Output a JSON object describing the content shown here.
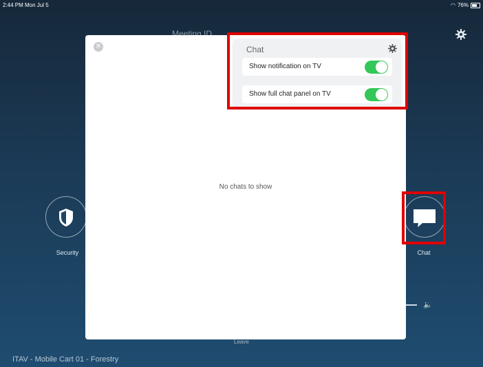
{
  "status": {
    "time": "2:44 PM  Mon Jul 5",
    "battery": "76%"
  },
  "background": {
    "meeting_title": "Meeting ID"
  },
  "side": {
    "security_label": "Security",
    "chat_label": "Chat",
    "leave_label": "Leave"
  },
  "footer": {
    "room_name": "ITAV - Mobile Cart 01 - Forestry"
  },
  "modal": {
    "empty_text": "No chats to show"
  },
  "popover": {
    "title": "Chat",
    "options": [
      {
        "label": "Show notification on TV",
        "enabled": true
      },
      {
        "label": "Show full chat panel on TV",
        "enabled": true
      }
    ]
  },
  "colors": {
    "toggle_on": "#34c759",
    "highlight": "#e00000",
    "accent": "#2bb673"
  }
}
